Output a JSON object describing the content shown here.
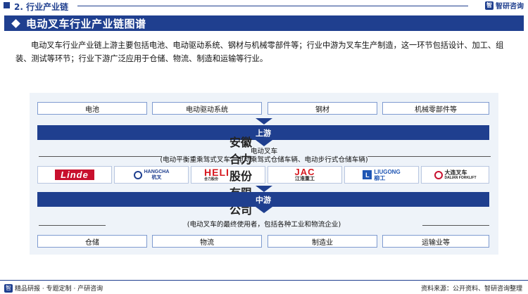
{
  "section": {
    "label": "2. 行业产业链",
    "brand": "智研咨询"
  },
  "banner": {
    "title": "电动叉车行业产业链图谱"
  },
  "intro": "电动叉车行业产业链上游主要包括电池、电动驱动系统、钢材与机械零部件等；行业中游为叉车生产制造，这一环节包括设计、加工、组装、测试等环节；行业下游广泛应用于仓储、物流、制造和运输等行业。",
  "diagram": {
    "upstream": {
      "items": [
        "电池",
        "电动驱动系统",
        "钢材",
        "机械零部件等"
      ],
      "stage_label": "上游"
    },
    "midstream": {
      "title": "电动叉车",
      "subtitle": "(电动平衡重乘驾式叉车、电动乘驾式仓储车辆、电动步行式仓储车辆)",
      "companies": [
        {
          "name": "Linde",
          "icon": "linde-logo"
        },
        {
          "name_en": "HANGCHA",
          "name_cn": "杭叉",
          "icon": "hangcha-logo"
        },
        {
          "name": "HELI",
          "sub": "合力股份",
          "side": "安徽合力股份 有限公司",
          "icon": "heli-logo"
        },
        {
          "name": "JAC",
          "sub": "江淮重工",
          "icon": "jac-logo"
        },
        {
          "name_en": "LIUGONG",
          "name_cn": "柳工",
          "icon": "liugong-logo"
        },
        {
          "name_cn": "大连叉车",
          "name_en": "DALIAN FORKLIFT",
          "icon": "dalian-forklift-logo"
        }
      ],
      "stage_label": "中游"
    },
    "downstream": {
      "subtitle": "(电动叉车的最终使用者，包括各种工业和物流企业)",
      "items": [
        "仓储",
        "物流",
        "制造业",
        "运输业等"
      ]
    }
  },
  "footer": {
    "left": "精品研报 · 专题定制 · 产研咨询",
    "right": "资料来源：公开资料、智研咨询整理"
  },
  "colors": {
    "primary": "#1f3f8f",
    "panel_bg": "#eef3f9",
    "box_border": "#7f9bd0",
    "red": "#c8102e"
  }
}
